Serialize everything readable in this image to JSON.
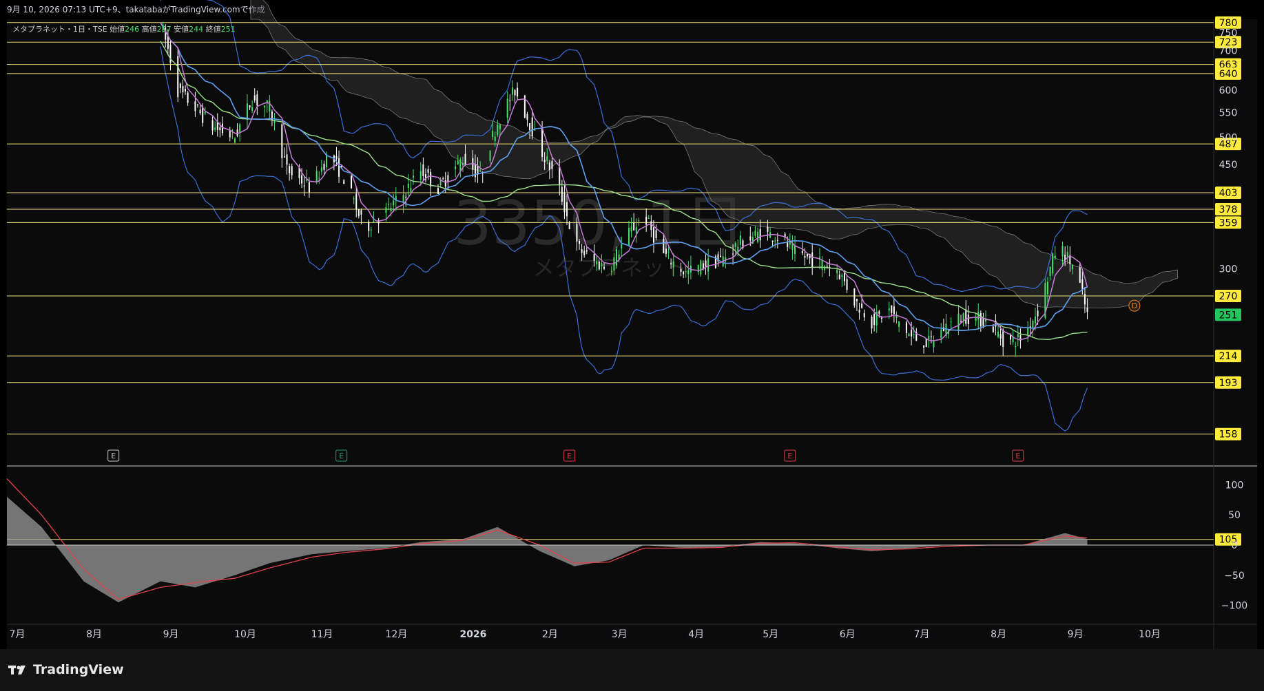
{
  "header": {
    "caption": "9月 10, 2026 07:13 UTC+9、takatabaがTradingView.comで作成"
  },
  "legend": {
    "symbol": "メタプラネット・1日・TSE",
    "open_label": "始値",
    "open": "246",
    "high_label": "高値",
    "high": "257",
    "low_label": "安値",
    "low": "244",
    "close_label": "終値",
    "close": "251"
  },
  "watermark": {
    "code": "3350, 1日",
    "name": "メタプラネット"
  },
  "branding": {
    "logo_text": "TradingView"
  },
  "colors": {
    "up": "#4ade6b",
    "down": "#ffffff",
    "hline": "#f2e27a",
    "price_tag": "#ffeb3b",
    "last_price": "#22c55e",
    "bollinger": "#3b6fd4",
    "ma_short": "#c77dd8",
    "ma_mid": "#5fa0f0",
    "ma_long": "#9ee08a",
    "cloud": "#3a3a3a",
    "oscillator": "#9a9a9a",
    "signal": "#e0434c"
  },
  "chart_data": [
    {
      "type": "candlestick",
      "title": "",
      "y_scale": "log",
      "ylim": [
        140,
        790
      ],
      "x_range": [
        "2025-07-01",
        "2026-10-31"
      ],
      "y_ticks": [
        750,
        700,
        600,
        550,
        500,
        450,
        300,
        250
      ],
      "x_ticks": [
        {
          "date": "2025-07-01",
          "label": "7月"
        },
        {
          "date": "2025-08-01",
          "label": "8月"
        },
        {
          "date": "2025-09-01",
          "label": "9月"
        },
        {
          "date": "2025-10-01",
          "label": "10月"
        },
        {
          "date": "2025-11-01",
          "label": "11月"
        },
        {
          "date": "2025-12-01",
          "label": "12月"
        },
        {
          "date": "2026-01-01",
          "label": "2026"
        },
        {
          "date": "2026-02-01",
          "label": "2月"
        },
        {
          "date": "2026-03-01",
          "label": "3月"
        },
        {
          "date": "2026-04-01",
          "label": "4月"
        },
        {
          "date": "2026-05-01",
          "label": "5月"
        },
        {
          "date": "2026-06-01",
          "label": "6月"
        },
        {
          "date": "2026-07-01",
          "label": "7月"
        },
        {
          "date": "2026-08-01",
          "label": "8月"
        },
        {
          "date": "2026-09-01",
          "label": "9月"
        },
        {
          "date": "2026-10-01",
          "label": "10月"
        }
      ],
      "horizontal_levels": [
        780,
        723,
        663,
        640,
        487,
        403,
        378,
        359,
        270,
        214,
        193,
        158,
        105
      ],
      "last_price": 251,
      "earnings_markers": [
        {
          "date": "2025-08-13",
          "label": "E"
        },
        {
          "date": "2025-11-13",
          "label": "E"
        },
        {
          "date": "2026-02-13",
          "label": "E"
        },
        {
          "date": "2026-05-13",
          "label": "E"
        },
        {
          "date": "2026-08-13",
          "label": "E"
        }
      ],
      "dividend_marker": {
        "date": "2026-09-29",
        "label": "D"
      },
      "price_path": [
        [
          "2025-09-01",
          780
        ],
        [
          "2025-09-08",
          600
        ],
        [
          "2025-09-15",
          560
        ],
        [
          "2025-09-22",
          520
        ],
        [
          "2025-10-01",
          500
        ],
        [
          "2025-10-08",
          580
        ],
        [
          "2025-10-15",
          560
        ],
        [
          "2025-10-22",
          440
        ],
        [
          "2025-11-01",
          410
        ],
        [
          "2025-11-08",
          470
        ],
        [
          "2025-11-15",
          420
        ],
        [
          "2025-11-22",
          350
        ],
        [
          "2025-12-01",
          375
        ],
        [
          "2025-12-08",
          400
        ],
        [
          "2025-12-15",
          440
        ],
        [
          "2025-12-22",
          410
        ],
        [
          "2026-01-01",
          460
        ],
        [
          "2026-01-08",
          430
        ],
        [
          "2026-01-15",
          530
        ],
        [
          "2026-01-22",
          600
        ],
        [
          "2026-02-01",
          480
        ],
        [
          "2026-02-08",
          420
        ],
        [
          "2026-02-15",
          330
        ],
        [
          "2026-02-22",
          310
        ],
        [
          "2026-03-01",
          300
        ],
        [
          "2026-03-08",
          340
        ],
        [
          "2026-03-15",
          370
        ],
        [
          "2026-03-22",
          320
        ],
        [
          "2026-04-01",
          295
        ],
        [
          "2026-04-08",
          305
        ],
        [
          "2026-04-15",
          310
        ],
        [
          "2026-04-22",
          330
        ],
        [
          "2026-05-01",
          345
        ],
        [
          "2026-05-08",
          340
        ],
        [
          "2026-05-15",
          320
        ],
        [
          "2026-05-22",
          310
        ],
        [
          "2026-06-01",
          300
        ],
        [
          "2026-06-08",
          265
        ],
        [
          "2026-06-15",
          245
        ],
        [
          "2026-06-22",
          255
        ],
        [
          "2026-07-01",
          230
        ],
        [
          "2026-07-08",
          225
        ],
        [
          "2026-07-15",
          240
        ],
        [
          "2026-07-22",
          250
        ],
        [
          "2026-08-01",
          245
        ],
        [
          "2026-08-08",
          225
        ],
        [
          "2026-08-15",
          230
        ],
        [
          "2026-08-22",
          260
        ],
        [
          "2026-08-29",
          330
        ],
        [
          "2026-09-05",
          300
        ],
        [
          "2026-09-10",
          251
        ]
      ]
    },
    {
      "type": "area",
      "title": "",
      "ylim": [
        -130,
        130
      ],
      "y_ticks": [
        100,
        50,
        0,
        -50,
        -100
      ],
      "series": [
        {
          "name": "",
          "x": [
            "2025-07-01",
            "2025-07-15",
            "2025-08-01",
            "2025-08-15",
            "2025-09-01",
            "2025-09-15",
            "2025-10-01",
            "2025-10-15",
            "2025-11-01",
            "2025-11-15",
            "2025-12-01",
            "2025-12-15",
            "2026-01-01",
            "2026-01-15",
            "2026-02-01",
            "2026-02-15",
            "2026-03-01",
            "2026-03-15",
            "2026-04-01",
            "2026-04-15",
            "2026-05-01",
            "2026-05-15",
            "2026-06-01",
            "2026-06-15",
            "2026-07-01",
            "2026-07-15",
            "2026-08-01",
            "2026-08-15",
            "2026-09-01",
            "2026-09-10"
          ],
          "values": [
            80,
            30,
            -60,
            -95,
            -60,
            -70,
            -50,
            -30,
            -15,
            -10,
            -5,
            5,
            10,
            30,
            -10,
            -35,
            -25,
            0,
            -5,
            -3,
            5,
            3,
            -5,
            -10,
            -5,
            0,
            0,
            0,
            20,
            10
          ]
        },
        {
          "name": "",
          "x": [
            "2025-07-01",
            "2025-07-15",
            "2025-08-01",
            "2025-08-15",
            "2025-09-01",
            "2025-09-15",
            "2025-10-01",
            "2025-10-15",
            "2025-11-01",
            "2025-11-15",
            "2025-12-01",
            "2025-12-15",
            "2026-01-01",
            "2026-01-15",
            "2026-02-01",
            "2026-02-15",
            "2026-03-01",
            "2026-03-15",
            "2026-04-01",
            "2026-04-15",
            "2026-05-01",
            "2026-05-15",
            "2026-06-01",
            "2026-06-15",
            "2026-07-01",
            "2026-07-15",
            "2026-08-01",
            "2026-08-15",
            "2026-09-01",
            "2026-09-10"
          ],
          "values": [
            110,
            50,
            -40,
            -90,
            -70,
            -62,
            -55,
            -38,
            -20,
            -12,
            -6,
            2,
            8,
            25,
            0,
            -30,
            -28,
            -5,
            -5,
            -4,
            3,
            4,
            -3,
            -8,
            -6,
            -2,
            0,
            0,
            15,
            12
          ]
        }
      ]
    }
  ]
}
